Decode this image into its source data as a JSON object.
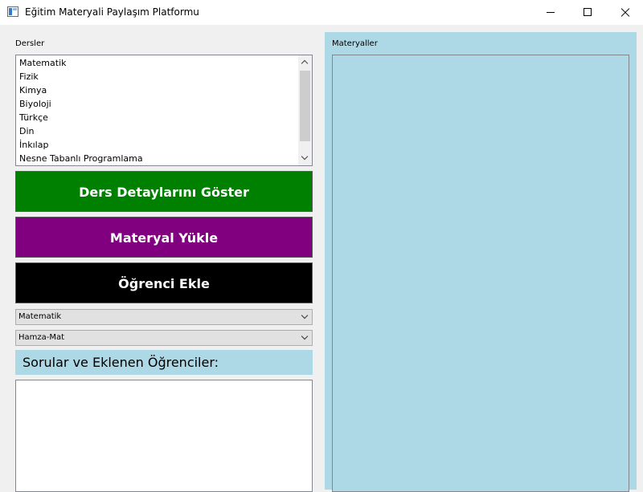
{
  "window": {
    "title": "Eğitim Materyali Paylaşım Platformu"
  },
  "courses": {
    "label": "Dersler",
    "items": [
      "Matematik",
      "Fizik",
      "Kimya",
      "Biyoloji",
      "Türkçe",
      "Din",
      "İnkılap",
      "Nesne Tabanlı Programlama"
    ]
  },
  "buttons": {
    "details": "Ders Detaylarını Göster",
    "upload": "Materyal Yükle",
    "add_student": "Öğrenci Ekle"
  },
  "selects": {
    "course_value": "Matematik",
    "material_value": "Hamza-Mat"
  },
  "questions": {
    "label": "Sorular ve Eklenen Öğrenciler:"
  },
  "materials": {
    "label": "Materyaller"
  },
  "colors": {
    "details_button": "#008000",
    "upload_button": "#800080",
    "student_button": "#000000",
    "panel_bg": "#add8e6"
  }
}
